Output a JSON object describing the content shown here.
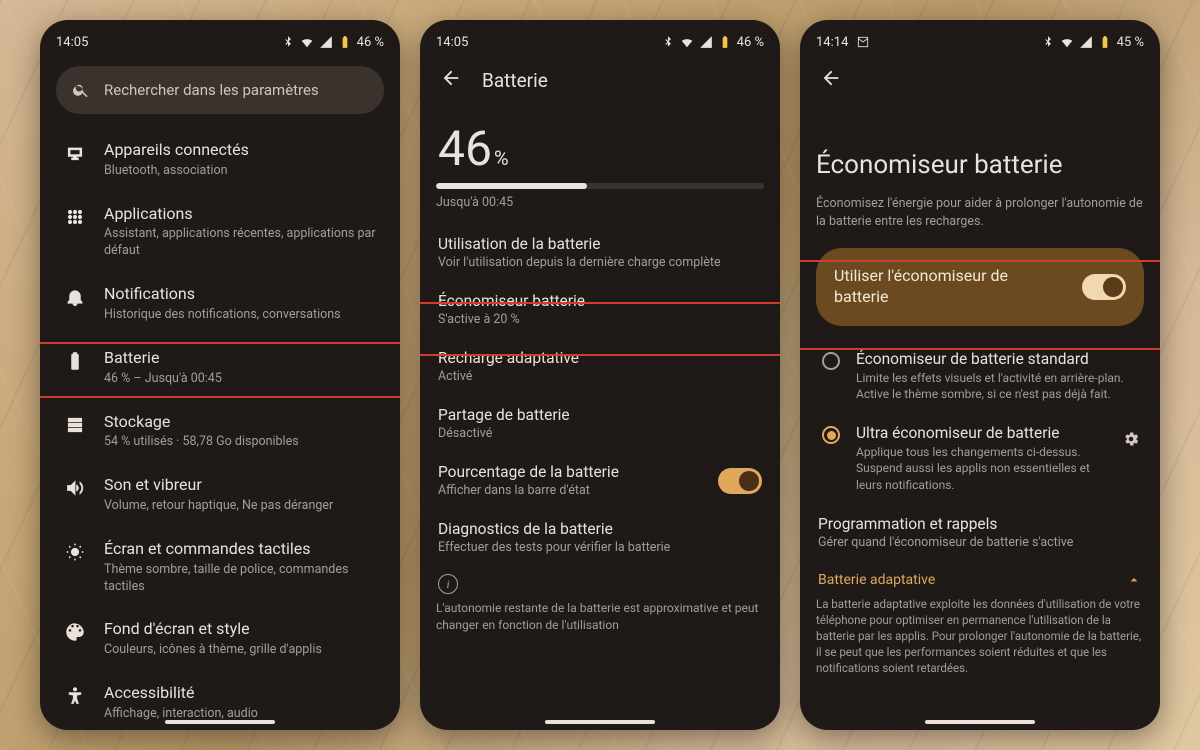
{
  "screen1": {
    "status": {
      "time": "14:05",
      "battery": "46 %"
    },
    "search_placeholder": "Rechercher dans les paramètres",
    "items": [
      {
        "title": "Appareils connectés",
        "sub": "Bluetooth, association"
      },
      {
        "title": "Applications",
        "sub": "Assistant, applications récentes, applications par défaut"
      },
      {
        "title": "Notifications",
        "sub": "Historique des notifications, conversations"
      },
      {
        "title": "Batterie",
        "sub": "46 % – Jusqu'à 00:45"
      },
      {
        "title": "Stockage",
        "sub": "54 % utilisés · 58,78 Go disponibles"
      },
      {
        "title": "Son et vibreur",
        "sub": "Volume, retour haptique, Ne pas déranger"
      },
      {
        "title": "Écran et commandes tactiles",
        "sub": "Thème sombre, taille de police, commandes tactiles"
      },
      {
        "title": "Fond d'écran et style",
        "sub": "Couleurs, icônes à thème, grille d'applis"
      },
      {
        "title": "Accessibilité",
        "sub": "Affichage, interaction, audio"
      }
    ]
  },
  "screen2": {
    "status": {
      "time": "14:05",
      "battery": "46 %"
    },
    "header": "Batterie",
    "percent_value": "46",
    "percent_unit": "%",
    "progress_pct": 46,
    "until": "Jusqu'à 00:45",
    "settings": [
      {
        "title": "Utilisation de la batterie",
        "sub": "Voir l'utilisation depuis la dernière charge complète"
      },
      {
        "title": "Économiseur batterie",
        "sub": "S'active à 20 %"
      },
      {
        "title": "Recharge adaptative",
        "sub": "Activé"
      },
      {
        "title": "Partage de batterie",
        "sub": "Désactivé"
      },
      {
        "title": "Pourcentage de la batterie",
        "sub": "Afficher dans la barre d'état"
      },
      {
        "title": "Diagnostics de la batterie",
        "sub": "Effectuer des tests pour vérifier la batterie"
      }
    ],
    "footnote": "L'autonomie restante de la batterie est approximative et peut changer en fonction de l'utilisation"
  },
  "screen3": {
    "status": {
      "time": "14:14",
      "battery": "45 %"
    },
    "title": "Économiseur batterie",
    "desc": "Économisez l'énergie pour aider à prolonger l'autonomie de la batterie entre les recharges.",
    "toggle_label": "Utiliser l'économiseur de batterie",
    "toggle_on": true,
    "radios": [
      {
        "title": "Économiseur de batterie standard",
        "sub": "Limite les effets visuels et l'activité en arrière-plan. Active le thème sombre, si ce n'est pas déjà fait.",
        "selected": false
      },
      {
        "title": "Ultra économiseur de batterie",
        "sub": "Applique tous les changements ci-dessus. Suspend aussi les applis non essentielles et leurs notifications.",
        "selected": true
      }
    ],
    "schedule": {
      "title": "Programmation et rappels",
      "sub": "Gérer quand l'économiseur de batterie s'active"
    },
    "adaptive_label": "Batterie adaptative",
    "adaptive_desc": "La batterie adaptative exploite les données d'utilisation de votre téléphone pour optimiser en permanence l'utilisation de la batterie par les applis. Pour prolonger l'autonomie de la batterie, il se peut que les performances soient réduites et que les notifications soient retardées."
  }
}
